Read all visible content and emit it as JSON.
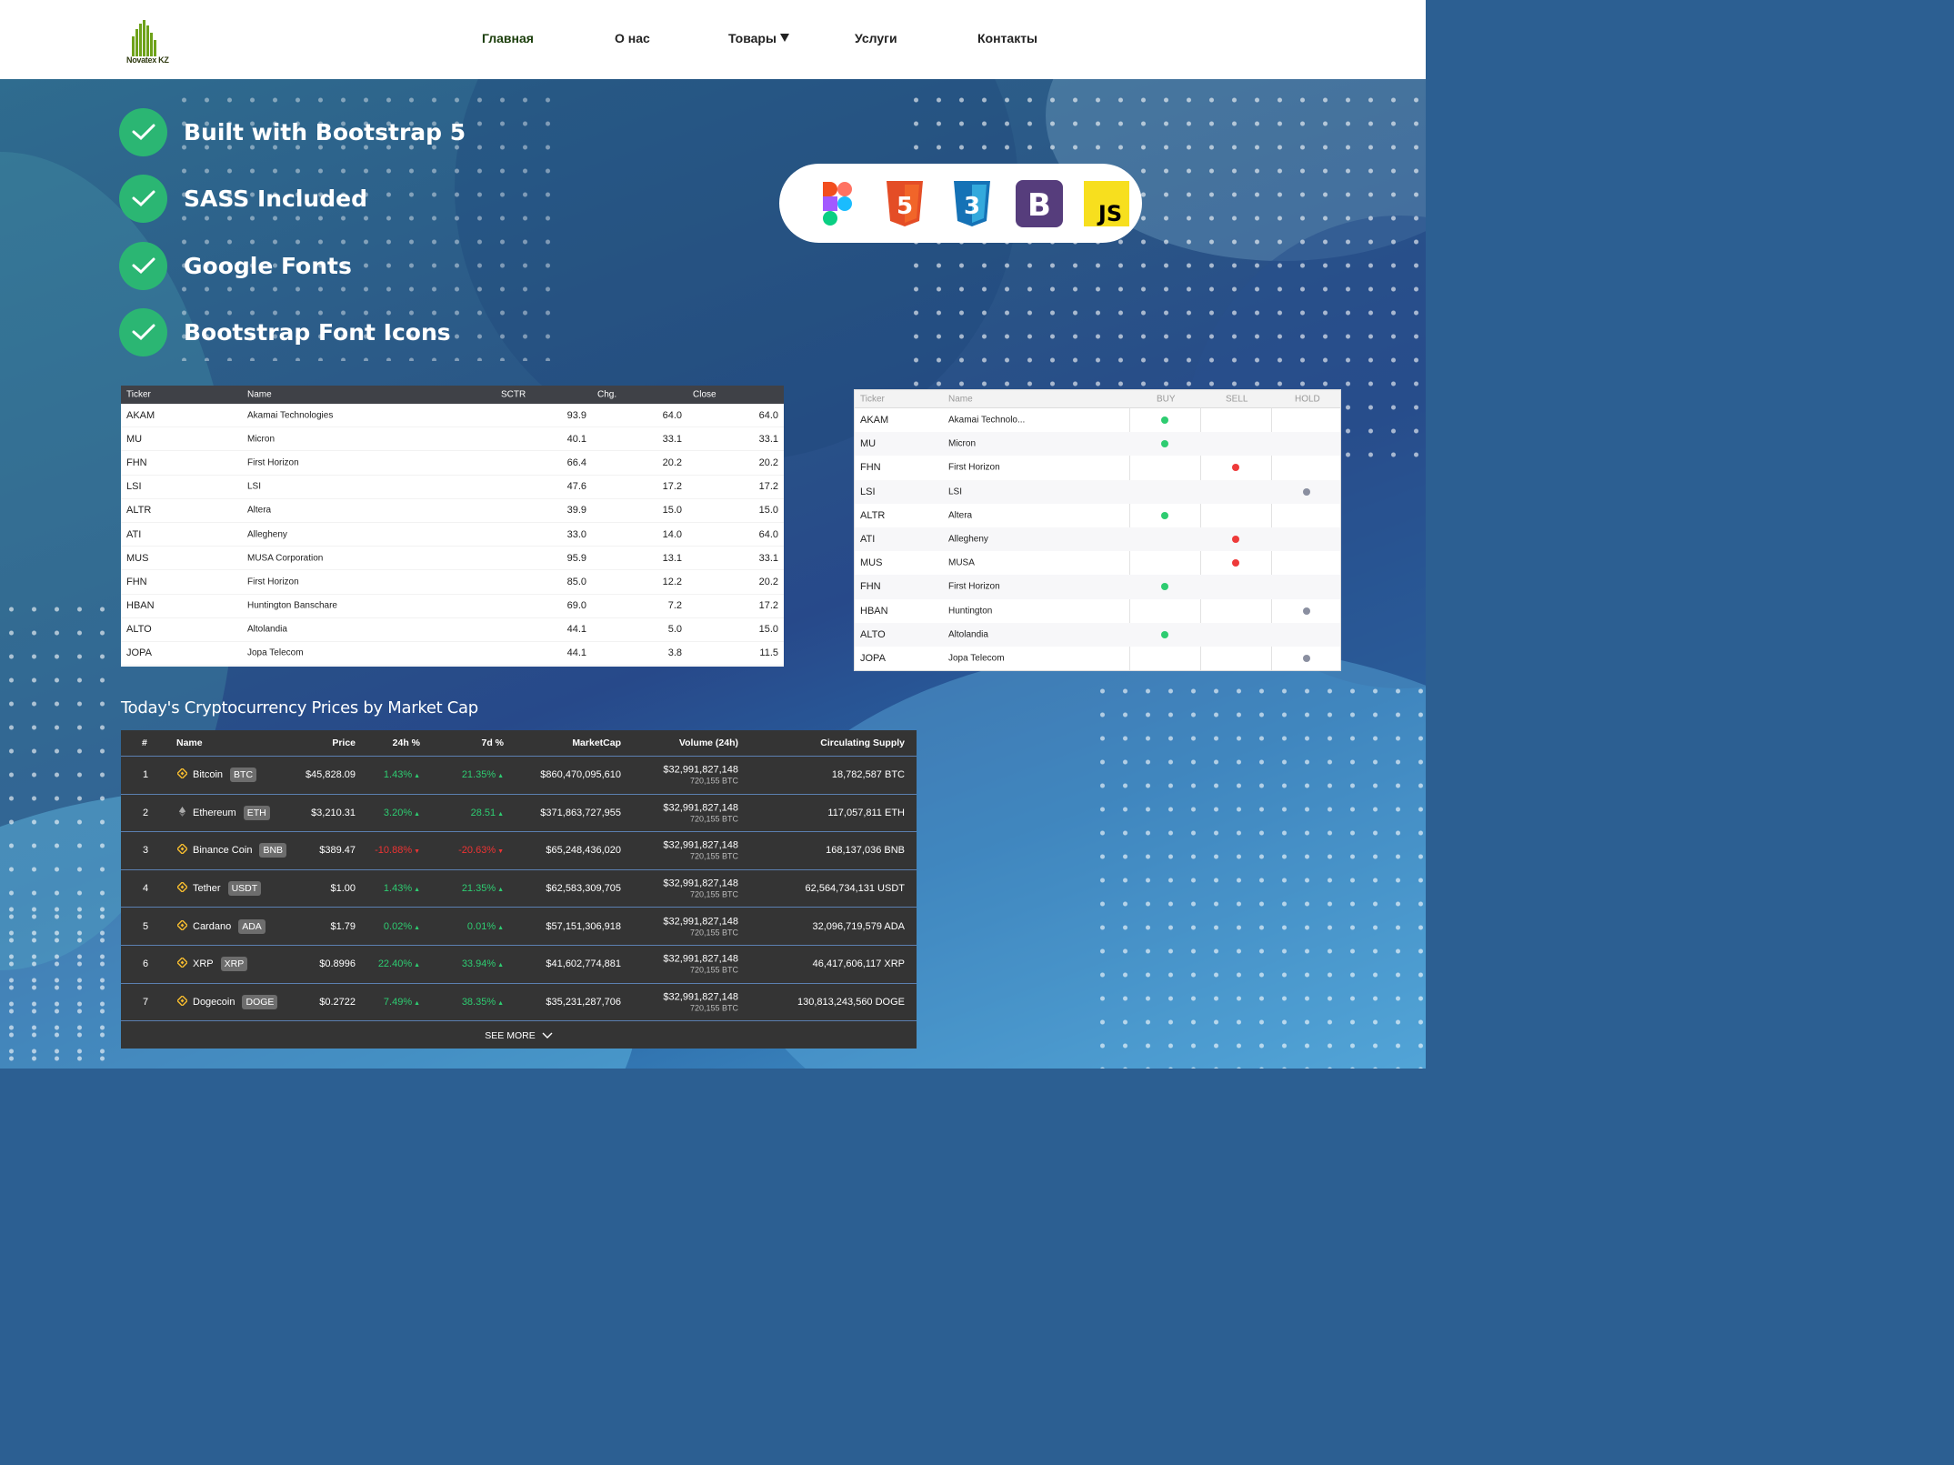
{
  "header": {
    "logo_text": "Novatex KZ",
    "nav": [
      {
        "label": "Главная",
        "active": true
      },
      {
        "label": "О нас"
      },
      {
        "label": "Товары",
        "dropdown": true
      },
      {
        "label": "Услуги"
      },
      {
        "label": "Контакты"
      }
    ]
  },
  "features": [
    "Built with Bootstrap 5",
    "SASS Included",
    "Google Fonts",
    "Bootstrap Font Icons"
  ],
  "tech_icons": [
    "figma-icon",
    "html5-icon",
    "css3-icon",
    "bootstrap-icon",
    "javascript-icon"
  ],
  "tech_labels": {
    "html": "5",
    "css": "3",
    "bootstrap": "B",
    "js": "JS"
  },
  "stock_table": {
    "headers": [
      "Ticker",
      "Name",
      "SCTR",
      "Chg.",
      "Close"
    ],
    "rows": [
      [
        "AKAM",
        "Akamai Technologies",
        "93.9",
        "64.0",
        "64.0"
      ],
      [
        "MU",
        "Micron",
        "40.1",
        "33.1",
        "33.1"
      ],
      [
        "FHN",
        "First Horizon",
        "66.4",
        "20.2",
        "20.2"
      ],
      [
        "LSI",
        "LSI",
        "47.6",
        "17.2",
        "17.2"
      ],
      [
        "ALTR",
        "Altera",
        "39.9",
        "15.0",
        "15.0"
      ],
      [
        "ATI",
        "Allegheny",
        "33.0",
        "14.0",
        "64.0"
      ],
      [
        "MUS",
        "MUSA Corporation",
        "95.9",
        "13.1",
        "33.1"
      ],
      [
        "FHN",
        "First Horizon",
        "85.0",
        "12.2",
        "20.2"
      ],
      [
        "HBAN",
        "Huntington Banschare",
        "69.0",
        "7.2",
        "17.2"
      ],
      [
        "ALTO",
        "Altolandia",
        "44.1",
        "5.0",
        "15.0"
      ],
      [
        "JOPA",
        "Jopa Telecom",
        "44.1",
        "3.8",
        "11.5"
      ]
    ]
  },
  "signal_table": {
    "headers": [
      "Ticker",
      "Name",
      "BUY",
      "SELL",
      "HOLD"
    ],
    "rows": [
      {
        "ticker": "AKAM",
        "name": "Akamai Technolo...",
        "signal": "buy"
      },
      {
        "ticker": "MU",
        "name": "Micron",
        "signal": "buy"
      },
      {
        "ticker": "FHN",
        "name": "First Horizon",
        "signal": "sell"
      },
      {
        "ticker": "LSI",
        "name": "LSI",
        "signal": "hold"
      },
      {
        "ticker": "ALTR",
        "name": "Altera",
        "signal": "buy"
      },
      {
        "ticker": "ATI",
        "name": "Allegheny",
        "signal": "sell"
      },
      {
        "ticker": "MUS",
        "name": "MUSA",
        "signal": "sell"
      },
      {
        "ticker": "FHN",
        "name": "First Horizon",
        "signal": "buy"
      },
      {
        "ticker": "HBAN",
        "name": "Huntington",
        "signal": "hold"
      },
      {
        "ticker": "ALTO",
        "name": "Altolandia",
        "signal": "buy"
      },
      {
        "ticker": "JOPA",
        "name": "Jopa Telecom",
        "signal": "hold"
      }
    ],
    "colors": {
      "buy": "#2ecc71",
      "sell": "#ee3a3a",
      "hold": "#8a8fa0"
    }
  },
  "crypto": {
    "title": "Today's Cryptocurrency Prices by Market Cap",
    "headers": [
      "#",
      "Name",
      "Price",
      "24h %",
      "7d %",
      "MarketCap",
      "Volume (24h)",
      "Circulating Supply"
    ],
    "rows": [
      {
        "rank": "1",
        "name": "Bitcoin",
        "symbol": "BTC",
        "price": "$45,828.09",
        "h24": "1.43%",
        "h24_dir": "up",
        "d7": "21.35%",
        "d7_dir": "up",
        "mcap": "$860,470,095,610",
        "vol": "$32,991,827,148",
        "vol_btc": "720,155 BTC",
        "supply": "18,782,587 BTC",
        "icon": "binance-diamond-icon"
      },
      {
        "rank": "2",
        "name": "Ethereum",
        "symbol": "ETH",
        "price": "$3,210.31",
        "h24": "3.20%",
        "h24_dir": "up",
        "d7": "28.51",
        "d7_dir": "up",
        "mcap": "$371,863,727,955",
        "vol": "$32,991,827,148",
        "vol_btc": "720,155 BTC",
        "supply": "117,057,811 ETH",
        "icon": "ethereum-icon"
      },
      {
        "rank": "3",
        "name": "Binance Coin",
        "symbol": "BNB",
        "price": "$389.47",
        "h24": "-10.88%",
        "h24_dir": "down",
        "d7": "-20.63%",
        "d7_dir": "down",
        "mcap": "$65,248,436,020",
        "vol": "$32,991,827,148",
        "vol_btc": "720,155 BTC",
        "supply": "168,137,036 BNB",
        "icon": "binance-diamond-icon"
      },
      {
        "rank": "4",
        "name": "Tether",
        "symbol": "USDT",
        "price": "$1.00",
        "h24": "1.43%",
        "h24_dir": "up",
        "d7": "21.35%",
        "d7_dir": "up",
        "mcap": "$62,583,309,705",
        "vol": "$32,991,827,148",
        "vol_btc": "720,155 BTC",
        "supply": "62,564,734,131 USDT",
        "icon": "binance-diamond-icon"
      },
      {
        "rank": "5",
        "name": "Cardano",
        "symbol": "ADA",
        "price": "$1.79",
        "h24": "0.02%",
        "h24_dir": "up",
        "d7": "0.01%",
        "d7_dir": "up",
        "mcap": "$57,151,306,918",
        "vol": "$32,991,827,148",
        "vol_btc": "720,155 BTC",
        "supply": "32,096,719,579 ADA",
        "icon": "binance-diamond-icon"
      },
      {
        "rank": "6",
        "name": "XRP",
        "symbol": "XRP",
        "price": "$0.8996",
        "h24": "22.40%",
        "h24_dir": "up",
        "d7": "33.94%",
        "d7_dir": "up",
        "mcap": "$41,602,774,881",
        "vol": "$32,991,827,148",
        "vol_btc": "720,155 BTC",
        "supply": "46,417,606,117 XRP",
        "icon": "binance-diamond-icon"
      },
      {
        "rank": "7",
        "name": "Dogecoin",
        "symbol": "DOGE",
        "price": "$0.2722",
        "h24": "7.49%",
        "h24_dir": "up",
        "d7": "38.35%",
        "d7_dir": "up",
        "mcap": "$35,231,287,706",
        "vol": "$32,991,827,148",
        "vol_btc": "720,155 BTC",
        "supply": "130,813,243,560 DOGE",
        "icon": "binance-diamond-icon"
      }
    ],
    "see_more": "SEE MORE"
  },
  "colors": {
    "check_green": "#2bb673",
    "up": "#2ecc71",
    "down": "#e33333",
    "figma": "#f24e1e",
    "html5": "#e44d26",
    "css3": "#1572b6",
    "bootstrap": "#563d7c",
    "js": "#f7df1e"
  }
}
